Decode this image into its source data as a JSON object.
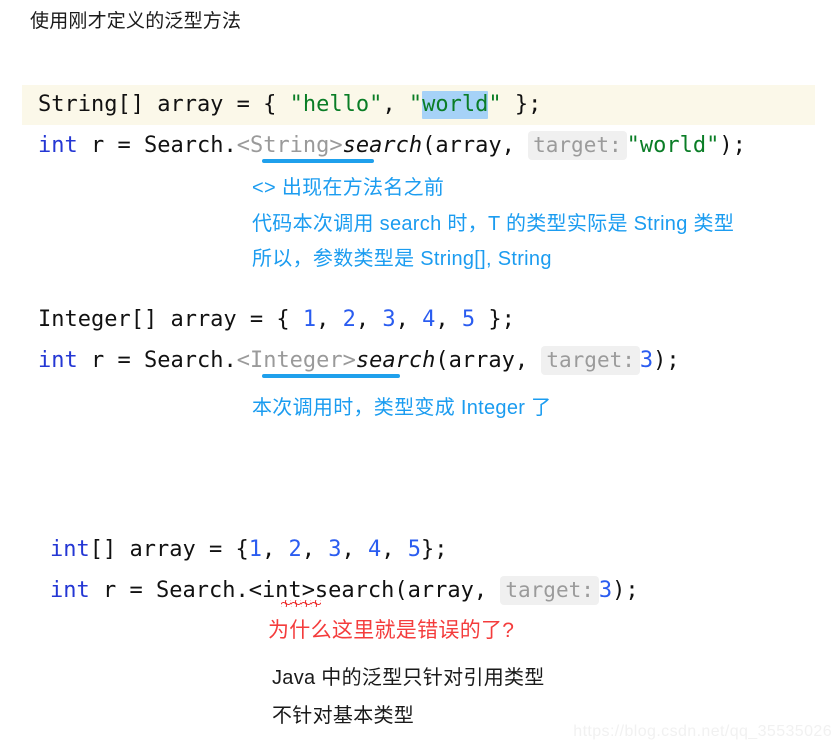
{
  "slide": {
    "title": "使用刚才定义的泛型方法"
  },
  "colors": {
    "keyword_blue": "#2437d4",
    "string_green": "#0a7d26",
    "number_blue": "#2a5cf0",
    "generic_grey": "#9a9a9a",
    "hint_chip_bg": "#f0f0f0",
    "selection_blue": "#a6d2f7",
    "current_line_cream": "#fbf8e9",
    "annotation_blue": "#1b9cf0",
    "annotation_red": "#f43c3c",
    "underline_blue": "#1fa0ec",
    "error_red": "#ee2b2b"
  },
  "blocks": [
    {
      "id": "string-example",
      "line1": {
        "t1": "String[] array = { ",
        "str1": "\"hello\"",
        "t2": ", ",
        "str2_open": "\"",
        "str2_sel": "world",
        "str2_close": "\"",
        "t3": " };"
      },
      "line2": {
        "kw": "int",
        "t1": " r = Search.",
        "generic": "<String>",
        "method": "search",
        "t2": "(array, ",
        "hint": "target:",
        "value": "\"world\"",
        "t3": ");"
      }
    },
    {
      "id": "integer-example",
      "line1": {
        "t1": "Integer[] array = { ",
        "n1": "1",
        "c1": ", ",
        "n2": "2",
        "c2": ", ",
        "n3": "3",
        "c3": ", ",
        "n4": "4",
        "c4": ", ",
        "n5": "5",
        "t2": " };"
      },
      "line2": {
        "kw": "int",
        "t1": " r = Search.",
        "generic": "<Integer>",
        "method": "search",
        "t2": "(array, ",
        "hint": "target:",
        "value": "3",
        "t3": ");"
      }
    },
    {
      "id": "int-primitive-example",
      "line1": {
        "kw": "int",
        "t1": "[] array = {",
        "n1": "1",
        "c1": ", ",
        "n2": "2",
        "c2": ", ",
        "n3": "3",
        "c3": ", ",
        "n4": "4",
        "c4": ", ",
        "n5": "5",
        "t2": "};"
      },
      "line2": {
        "kw": "int",
        "t1": " r = Search.<",
        "err": "int",
        "t2": ">search(array, ",
        "hint": "target:",
        "value": "3",
        "t3": ");"
      }
    }
  ],
  "annotations": {
    "string_note_1": "<> 出现在方法名之前",
    "string_note_2": "代码本次调用 search 时，T 的类型实际是 String 类型",
    "string_note_3": "所以，参数类型是 String[], String",
    "integer_note": "本次调用时，类型变成 Integer 了",
    "error_question": "为什么这里就是错误的了?",
    "conclusion_1": "Java 中的泛型只针对引用类型",
    "conclusion_2": "不针对基本类型"
  },
  "watermark": {
    "url": "https://blog.csdn.net/qq_35535026"
  }
}
